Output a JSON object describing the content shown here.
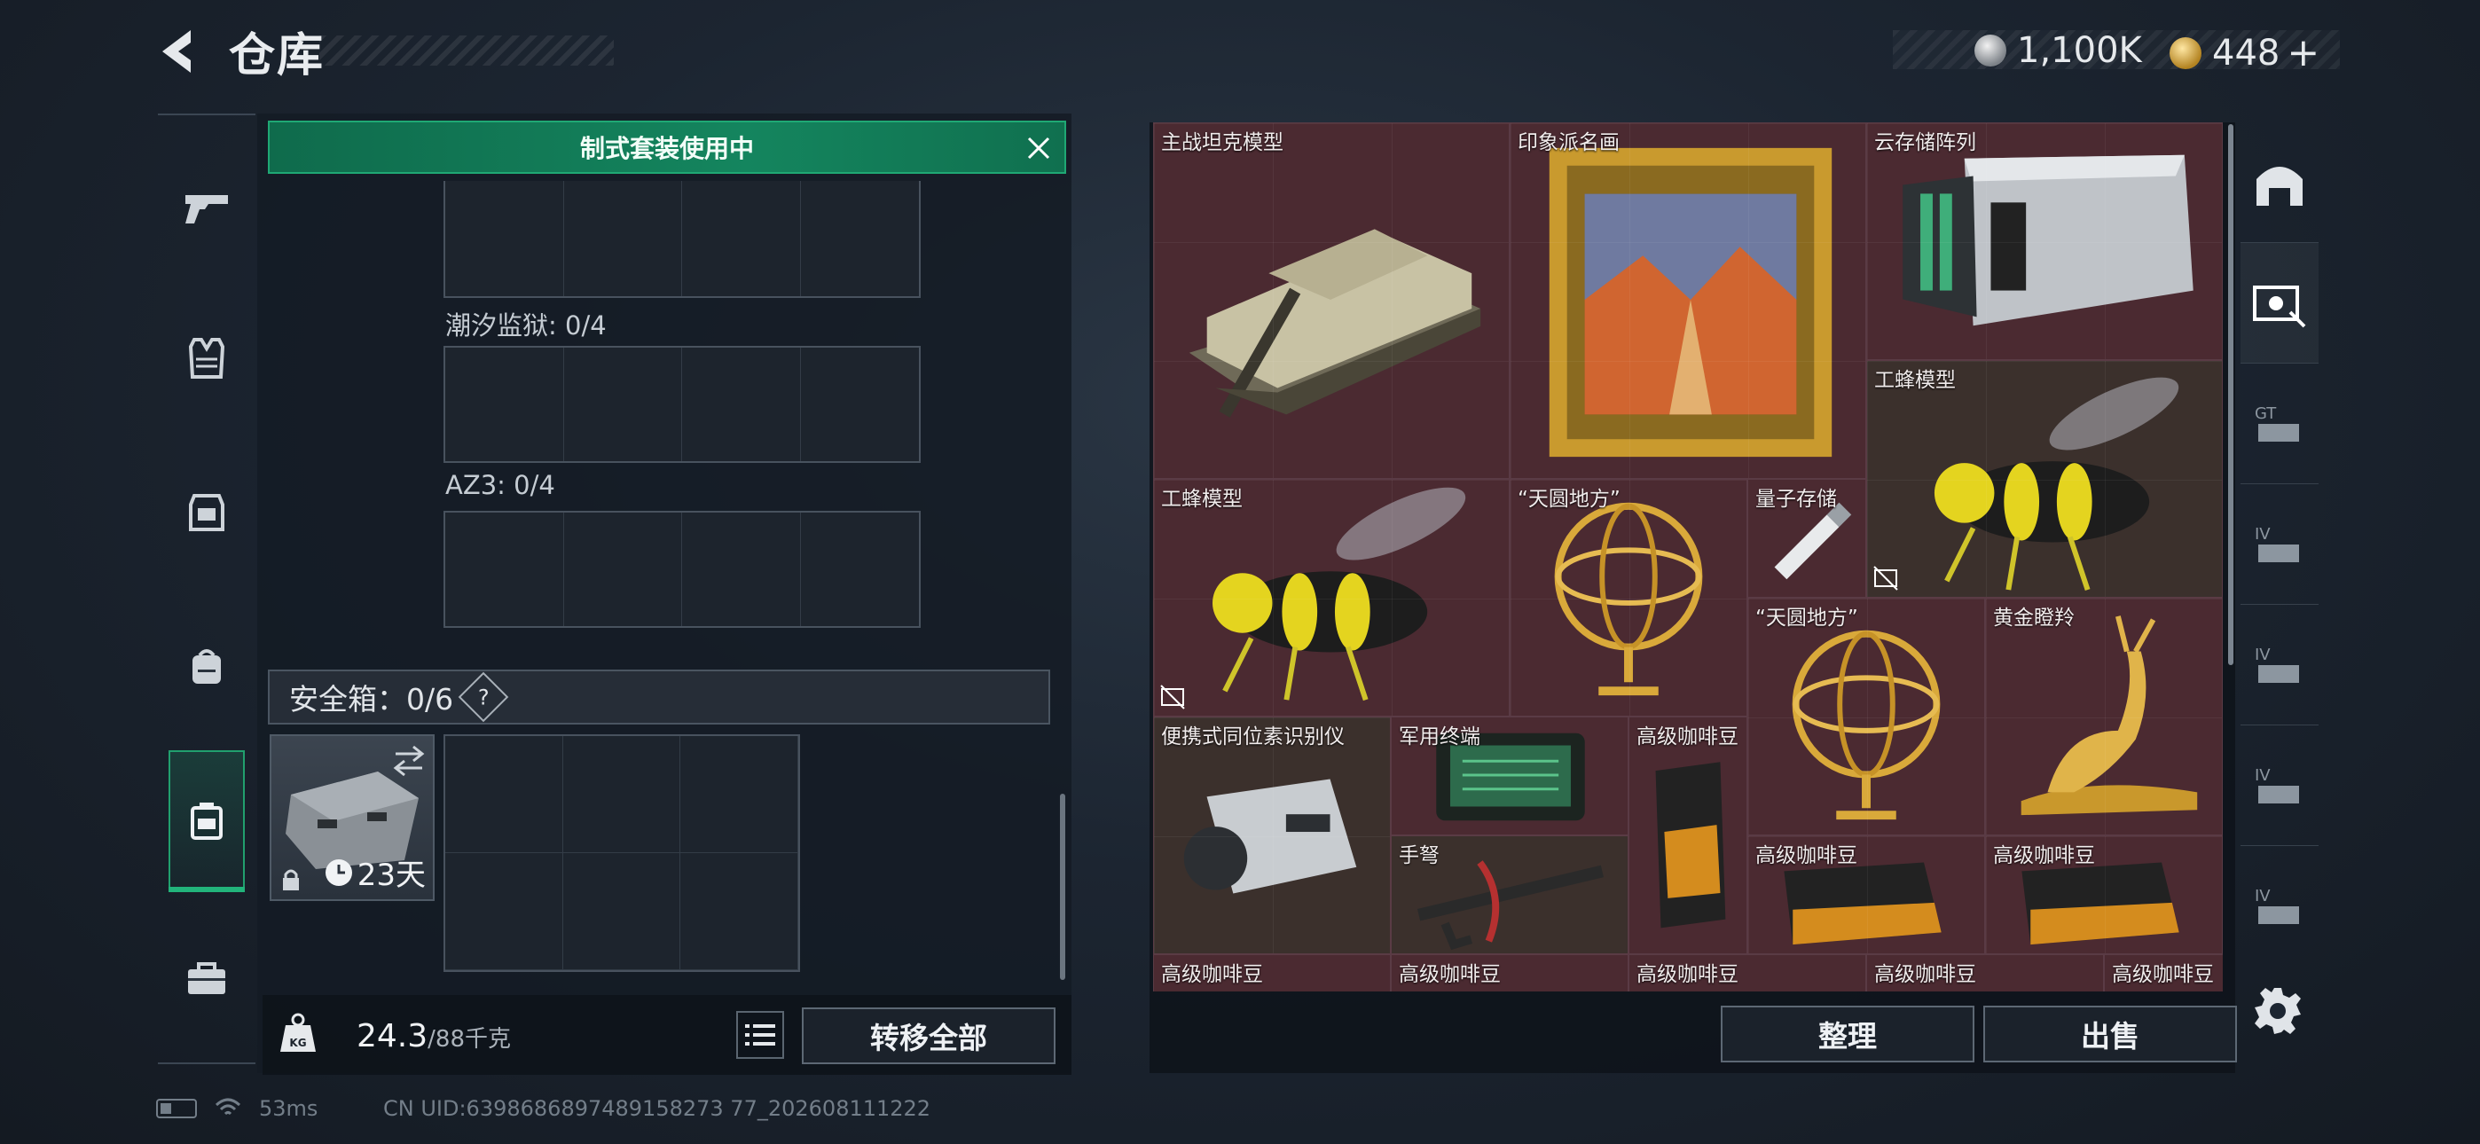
{
  "header": {
    "title": "仓库",
    "back_icon": "back-arrow-icon"
  },
  "currency": {
    "silver": "1,100K",
    "gold": "448",
    "add_label": "+"
  },
  "left_nav": [
    {
      "name": "weapons",
      "icon": "pistol-icon"
    },
    {
      "name": "armor",
      "icon": "armor-vest-icon"
    },
    {
      "name": "chest-rig",
      "icon": "chest-rig-icon"
    },
    {
      "name": "backpack",
      "icon": "backpack-icon"
    },
    {
      "name": "storage",
      "icon": "storage-case-icon",
      "active": true
    },
    {
      "name": "toolbox",
      "icon": "briefcase-icon"
    }
  ],
  "loadout": {
    "banner": "制式套装使用中",
    "slots": [
      {
        "label": "潮汐监狱: 0/4"
      },
      {
        "label": "AZ3: 0/4"
      }
    ],
    "safe_box_label": "安全箱：0/6",
    "safe_box_help": "?",
    "safe_case_days": "23天",
    "weight_value": "24.3",
    "weight_max": "/88千克",
    "transfer_all": "转移全部"
  },
  "stash": {
    "items": [
      {
        "name": "主战坦克模型",
        "kind": "tank",
        "bg": "r"
      },
      {
        "name": "印象派名画",
        "kind": "painting",
        "bg": "r"
      },
      {
        "name": "云存储阵列",
        "kind": "server",
        "bg": "r"
      },
      {
        "name": "工蜂模型",
        "kind": "bee",
        "bg": "b"
      },
      {
        "name": "工蜂模型",
        "kind": "bee",
        "bg": "r"
      },
      {
        "name": "“天圆地方”",
        "kind": "globe",
        "bg": "r"
      },
      {
        "name": "量子存储",
        "kind": "usb",
        "bg": "r"
      },
      {
        "name": "“天圆地方”",
        "kind": "globe",
        "bg": "r"
      },
      {
        "name": "黄金瞪羚",
        "kind": "gazelle",
        "bg": "r"
      },
      {
        "name": "便携式同位素识别仪",
        "kind": "scanner",
        "bg": "b"
      },
      {
        "name": "军用终端",
        "kind": "terminal",
        "bg": "r"
      },
      {
        "name": "高级咖啡豆",
        "kind": "coffee",
        "bg": "r"
      },
      {
        "name": "手弩",
        "kind": "crossbow",
        "bg": "b"
      },
      {
        "name": "高级咖啡豆",
        "kind": "coffee",
        "bg": "r"
      },
      {
        "name": "高级咖啡豆",
        "kind": "coffee",
        "bg": "r"
      },
      {
        "name": "高级咖啡豆",
        "kind": "coffee",
        "bg": "r"
      },
      {
        "name": "高级咖啡豆",
        "kind": "coffee",
        "bg": "r"
      },
      {
        "name": "高级咖啡豆",
        "kind": "coffee",
        "bg": "r"
      },
      {
        "name": "高级咖啡豆",
        "kind": "coffee",
        "bg": "r"
      },
      {
        "name": "高级咖啡豆",
        "kind": "coffee",
        "bg": "r"
      }
    ],
    "sort_label": "整理",
    "sell_label": "出售"
  },
  "right_nav": [
    {
      "name": "home-storage",
      "icon": "storage-arch-icon"
    },
    {
      "name": "stash-1",
      "icon": "stash-box-icon",
      "active": true
    },
    {
      "name": "stash-gt",
      "icon": "stash-gt-icon"
    },
    {
      "name": "stash-iv-1",
      "icon": "stash-iv-icon"
    },
    {
      "name": "stash-iv-2",
      "icon": "stash-iv-icon"
    },
    {
      "name": "stash-iv-3",
      "icon": "stash-iv-icon"
    },
    {
      "name": "stash-iv-4",
      "icon": "stash-iv-icon"
    }
  ],
  "status": {
    "ping": "53ms",
    "uid": "CN UID:6398686897489158273 77_202608111222"
  },
  "colors": {
    "accent_green": "#1fa874",
    "stash_red": "#4b2a31",
    "stash_brown": "#3b302c"
  }
}
